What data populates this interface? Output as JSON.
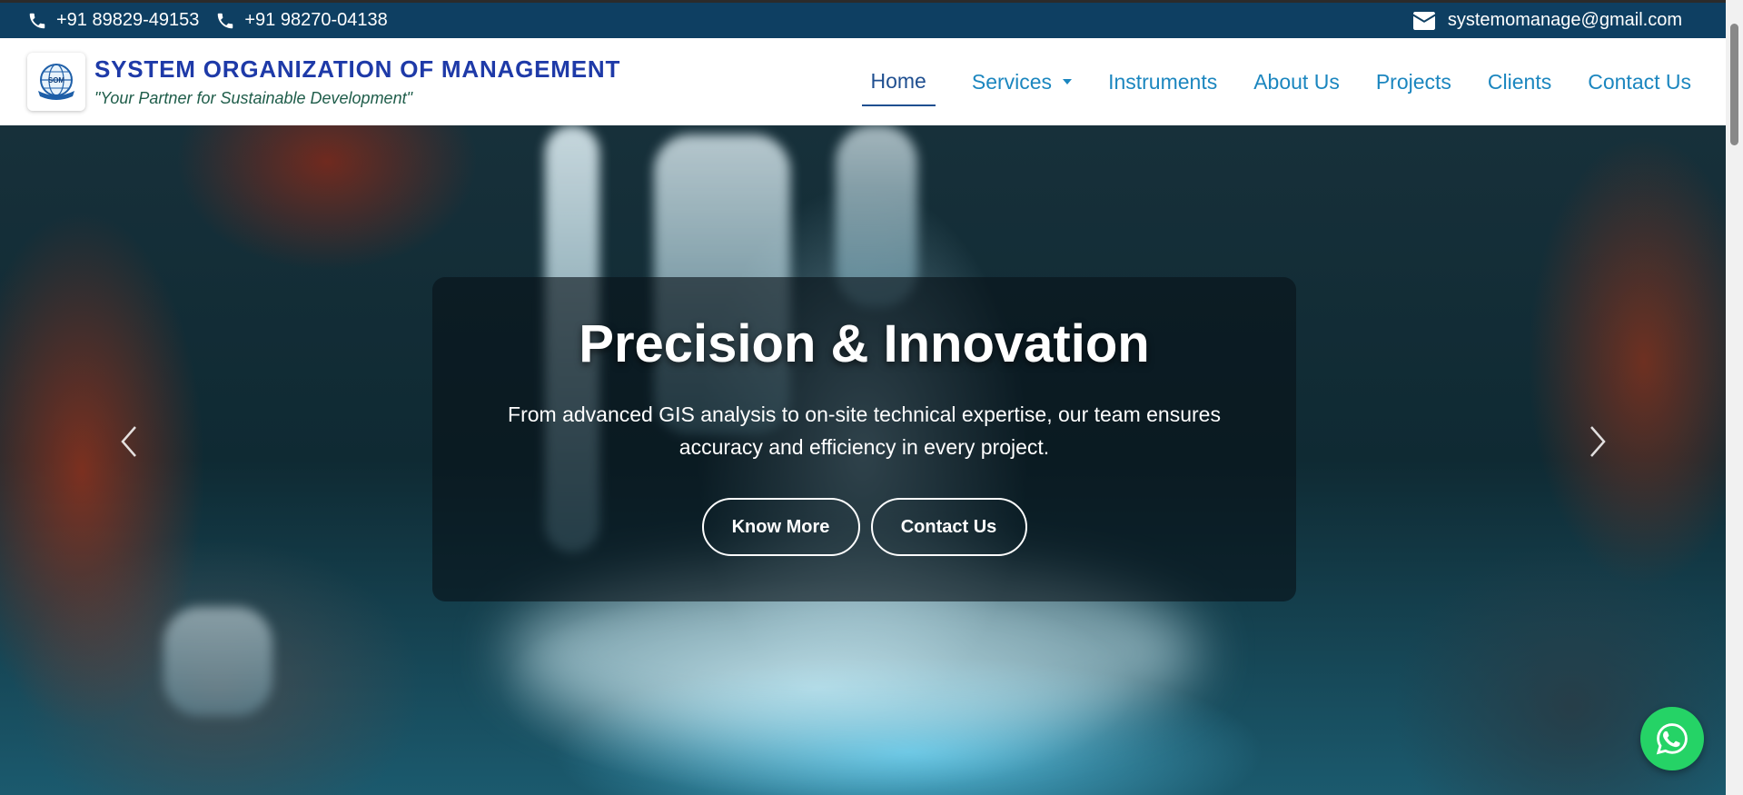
{
  "topbar": {
    "phone1": "+91 89829-49153",
    "phone2": "+91 98270-04138",
    "email": "systemomanage@gmail.com"
  },
  "brand": {
    "name": "SYSTEM ORGANIZATION OF MANAGEMENT",
    "tagline": "\"Your Partner for Sustainable Development\"",
    "logo_text": "SOM"
  },
  "nav": {
    "items": [
      "Home",
      "Services",
      "Instruments",
      "About Us",
      "Projects",
      "Clients",
      "Contact Us"
    ],
    "active": "Home"
  },
  "hero": {
    "title": "Precision & Innovation",
    "subtitle": "From advanced GIS analysis to on-site technical expertise, our team ensures accuracy and efficiency in every project.",
    "know_more": "Know More",
    "contact_us": "Contact Us"
  },
  "colors": {
    "topbar_bg": "#0e3f62",
    "brand_blue": "#1e3aa8",
    "nav_link": "#1b86bf",
    "whatsapp": "#25d366"
  },
  "icons": {
    "phone": "phone-icon",
    "email": "envelope-icon",
    "prev": "chevron-left-icon",
    "next": "chevron-right-icon",
    "whatsapp": "whatsapp-icon",
    "dropdown": "caret-down-icon"
  }
}
